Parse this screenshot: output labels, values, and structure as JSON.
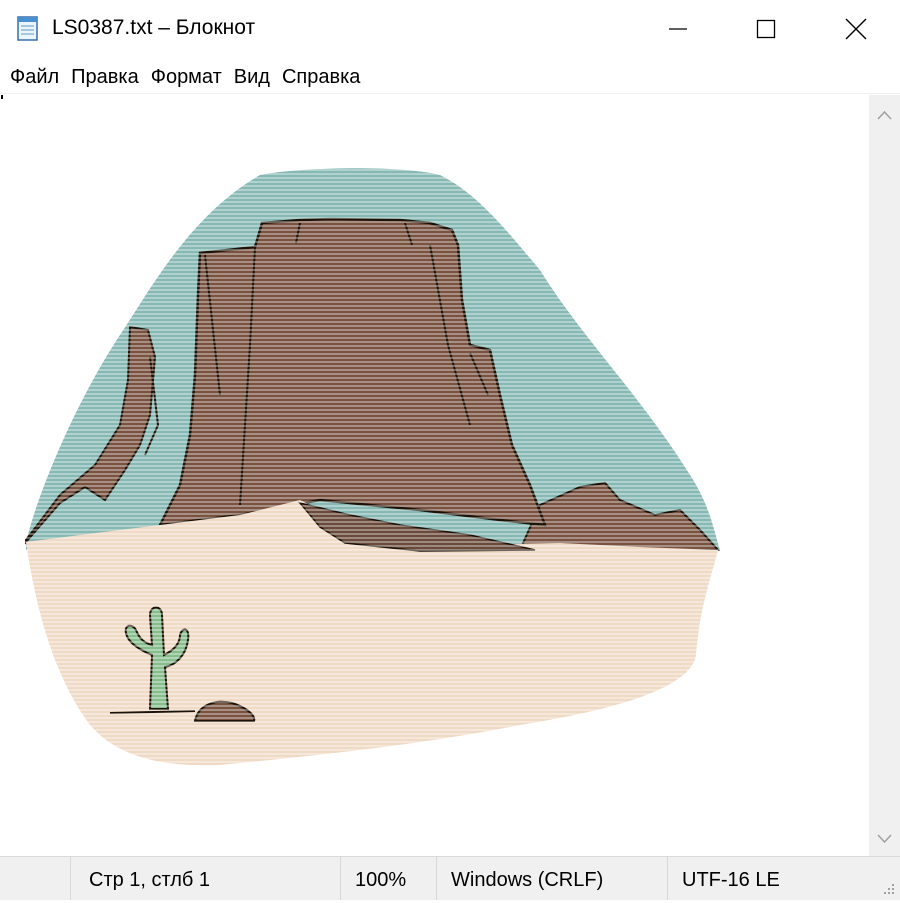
{
  "window": {
    "title": "LS0387.txt – Блокнот",
    "controls": [
      "minimize-icon",
      "maximize-icon",
      "close-icon"
    ]
  },
  "menu": {
    "items": [
      "Файл",
      "Правка",
      "Формат",
      "Вид",
      "Справка"
    ]
  },
  "editor": {
    "content_description": "desert-mesa-ascii-art",
    "colors": {
      "sky": "#86b8b4",
      "mesa": "#7a5340",
      "outline": "#1c1208",
      "sand": "#efdac6",
      "cactus": "#86bd8c"
    }
  },
  "statusbar": {
    "position": "Стр 1, стлб 1",
    "zoom": "100%",
    "line_endings": "Windows (CRLF)",
    "encoding": "UTF-16 LE"
  }
}
